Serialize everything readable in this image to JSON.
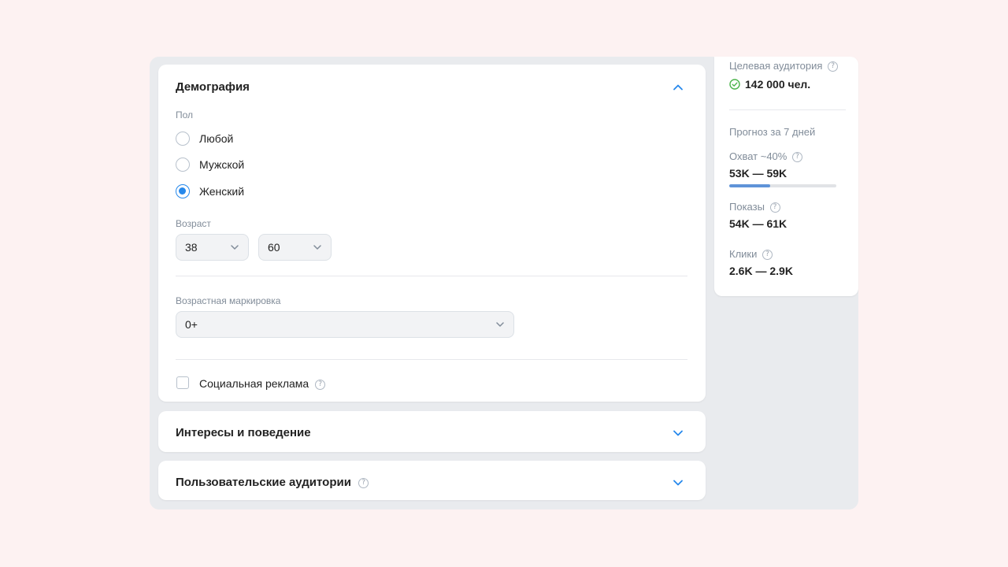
{
  "demography": {
    "title": "Демография",
    "gender_label": "Пол",
    "gender_options": [
      {
        "label": "Любой",
        "checked": false
      },
      {
        "label": "Мужской",
        "checked": false
      },
      {
        "label": "Женский",
        "checked": true
      }
    ],
    "age_label": "Возраст",
    "age_from": "38",
    "age_to": "60",
    "age_rating_label": "Возрастная маркировка",
    "age_rating_value": "0+",
    "social_ad_label": "Социальная реклама",
    "social_ad_checked": false
  },
  "interests": {
    "title": "Интересы и поведение"
  },
  "custom_audiences": {
    "title": "Пользовательские аудитории"
  },
  "sidebar": {
    "target_audience_label": "Целевая аудитория",
    "target_audience_value": "142 000 чел.",
    "forecast_label": "Прогноз за 7 дней",
    "reach_label": "Охват ~40%",
    "reach_value": "53K — 59K",
    "reach_progress": 0.38,
    "impressions_label": "Показы",
    "impressions_value": "54K — 61K",
    "clicks_label": "Клики",
    "clicks_value": "2.6K — 2.9K"
  },
  "help_glyph": "?",
  "colors": {
    "accent": "#2688eb",
    "success": "#4bb34b",
    "progress": "#5f93d8"
  }
}
